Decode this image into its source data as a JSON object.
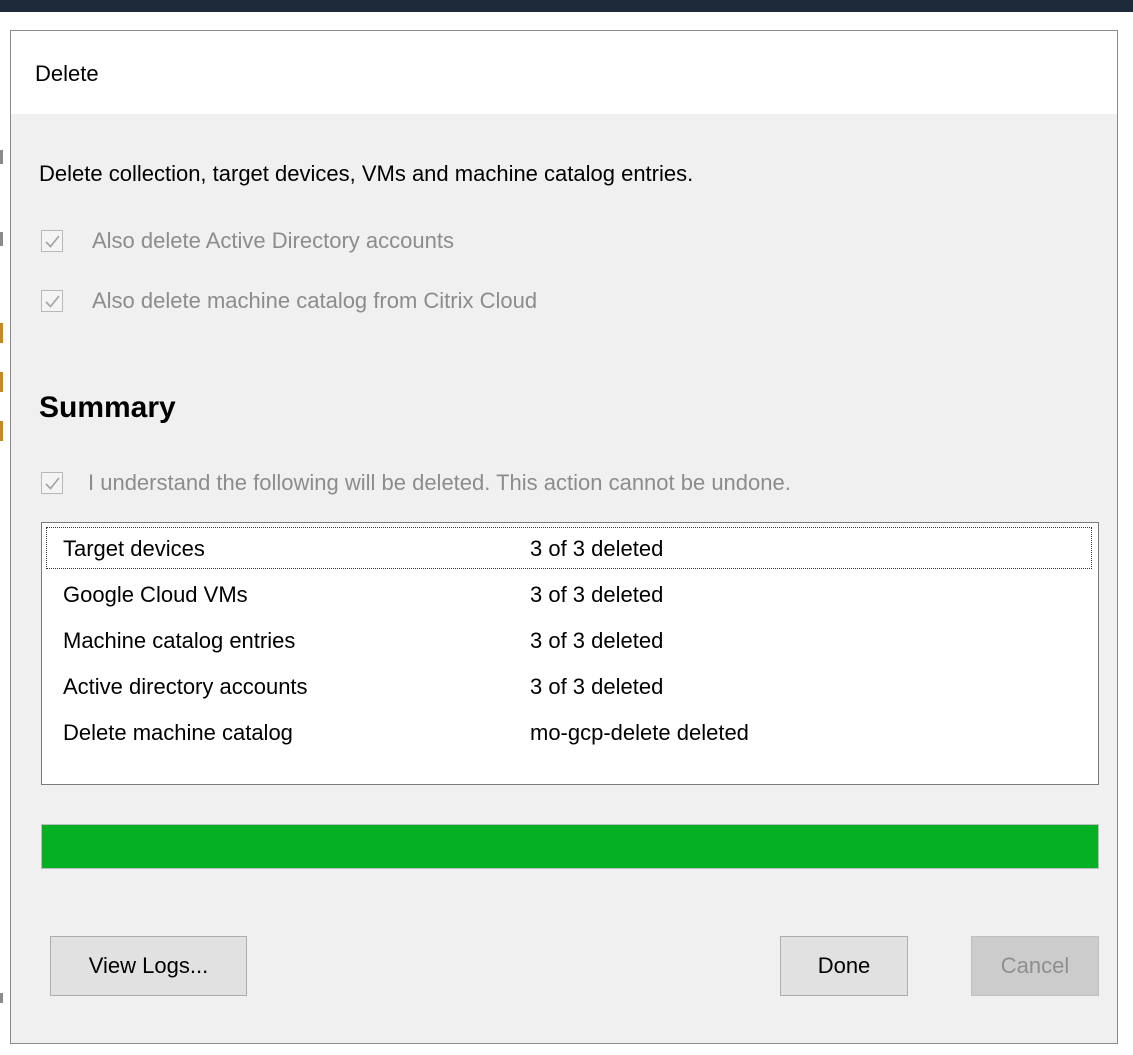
{
  "dialog": {
    "title": "Delete",
    "description": "Delete collection, target devices, VMs and machine catalog entries."
  },
  "options": [
    {
      "label": "Also delete Active Directory accounts",
      "checked": true,
      "enabled": false
    },
    {
      "label": "Also delete machine catalog from Citrix Cloud",
      "checked": true,
      "enabled": false
    }
  ],
  "summary": {
    "heading": "Summary",
    "confirm_label": "I understand the following will be deleted. This action cannot be undone.",
    "confirm_checked": true,
    "rows": [
      {
        "name": "Target devices",
        "status": "3 of 3 deleted"
      },
      {
        "name": "Google Cloud VMs",
        "status": "3 of 3 deleted"
      },
      {
        "name": "Machine catalog entries",
        "status": "3 of 3 deleted"
      },
      {
        "name": "Active directory accounts",
        "status": "3 of 3 deleted"
      },
      {
        "name": "Delete machine catalog",
        "status": "mo-gcp-delete deleted"
      }
    ]
  },
  "progress": {
    "percent": 100,
    "color": "#06b025"
  },
  "buttons": {
    "view_logs": "View Logs...",
    "done": "Done",
    "cancel": "Cancel"
  },
  "icons": {
    "checkbox_check": "check-icon"
  }
}
